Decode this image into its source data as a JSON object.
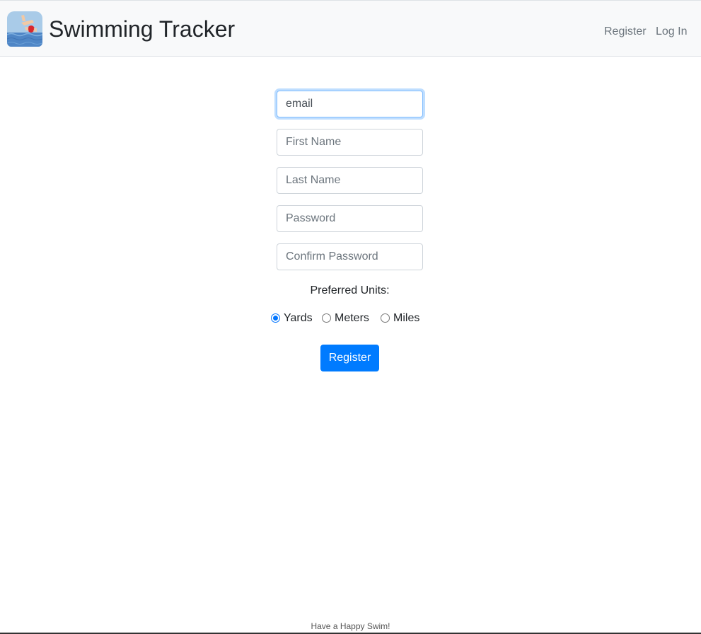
{
  "header": {
    "logo_icon": "swimmer-logo-icon",
    "title": "Swimming Tracker",
    "nav": {
      "register_label": "Register",
      "login_label": "Log In"
    }
  },
  "form": {
    "email": {
      "placeholder": "email",
      "value": "",
      "focused": true
    },
    "first_name": {
      "placeholder": "First Name",
      "value": ""
    },
    "last_name": {
      "placeholder": "Last Name",
      "value": ""
    },
    "password": {
      "placeholder": "Password",
      "value": ""
    },
    "confirm_password": {
      "placeholder": "Confirm Password",
      "value": ""
    },
    "units_label": "Preferred Units:",
    "units": [
      {
        "label": "Yards",
        "checked": true
      },
      {
        "label": "Meters",
        "checked": false
      },
      {
        "label": "Miles",
        "checked": false
      }
    ],
    "submit_label": "Register"
  },
  "footer": {
    "text": "Have a Happy Swim!"
  },
  "colors": {
    "primary": "#007bff",
    "navbar_bg": "#f8f9fa",
    "nav_link": "#6c757d"
  }
}
